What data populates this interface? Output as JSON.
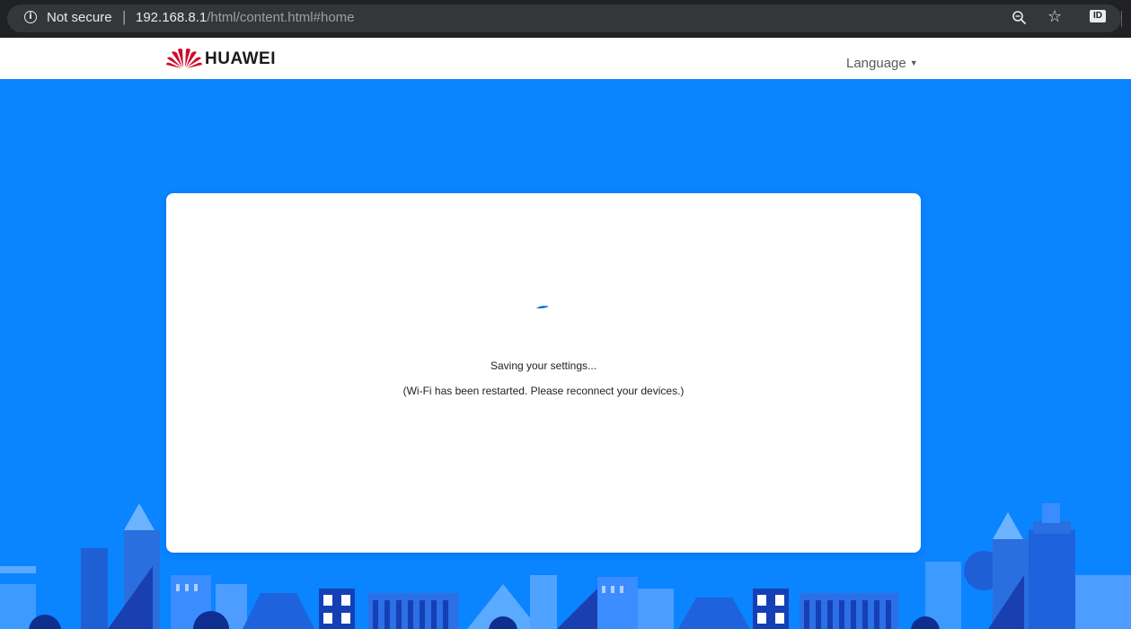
{
  "browser": {
    "security_label": "Not secure",
    "url_host": "192.168.8.1",
    "url_path": "/html/content.html#home",
    "extension_label": "ID"
  },
  "header": {
    "brand": "HUAWEI",
    "language_label": "Language"
  },
  "status": {
    "saving": "Saving your settings...",
    "restart_notice": "(Wi-Fi has been restarted. Please reconnect your devices.)"
  },
  "colors": {
    "brand_red": "#cf0a2c",
    "background_blue": "#0a84ff"
  }
}
